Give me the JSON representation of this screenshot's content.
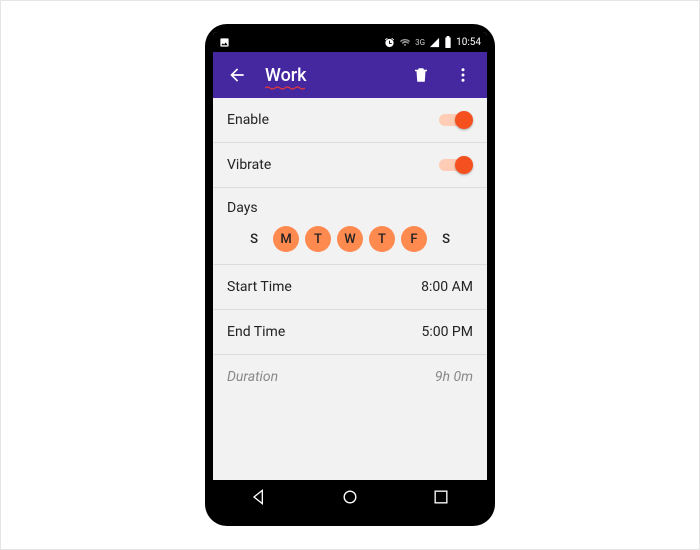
{
  "statusbar": {
    "time": "10:54",
    "network_label": "3G"
  },
  "appbar": {
    "title": "Work"
  },
  "icons": {
    "back": "back-arrow-icon",
    "delete": "trash-icon",
    "overflow": "more-vert-icon",
    "alarm": "alarm-icon",
    "wifi": "wifi-icon",
    "signal": "signal-icon",
    "battery": "battery-icon",
    "notif": "image-notification-icon"
  },
  "rows": {
    "enable": {
      "label": "Enable",
      "value": true
    },
    "vibrate": {
      "label": "Vibrate",
      "value": true
    },
    "days": {
      "label": "Days"
    },
    "start": {
      "label": "Start Time",
      "value": "8:00 AM"
    },
    "end": {
      "label": "End Time",
      "value": "5:00 PM"
    },
    "duration": {
      "label": "Duration",
      "value": "9h 0m"
    }
  },
  "days": [
    {
      "letter": "S",
      "selected": false
    },
    {
      "letter": "M",
      "selected": true
    },
    {
      "letter": "T",
      "selected": true
    },
    {
      "letter": "W",
      "selected": true
    },
    {
      "letter": "T",
      "selected": true
    },
    {
      "letter": "F",
      "selected": true
    },
    {
      "letter": "S",
      "selected": false
    }
  ],
  "colors": {
    "accent": "#f4511e",
    "appbar": "#4527a0",
    "day_on": "#ff8a50"
  }
}
